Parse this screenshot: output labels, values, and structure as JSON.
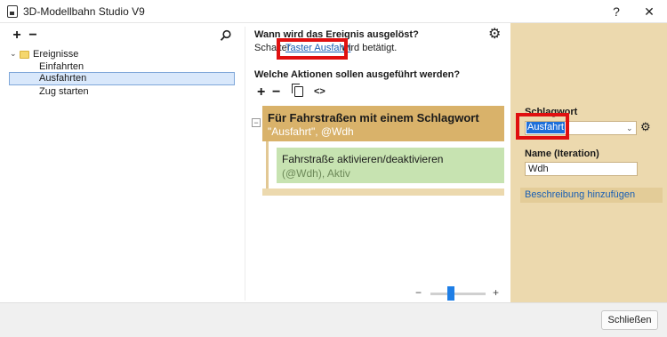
{
  "window": {
    "title": "3D-Modellbahn Studio V9",
    "help_label": "?",
    "close_label": "✕"
  },
  "tree": {
    "add_label": "+",
    "remove_label": "−",
    "search_icon": "🔍",
    "root": {
      "expand_icon": "⌄",
      "label": "Ereignisse",
      "icon": "folder-icon"
    },
    "children": [
      {
        "label": "Einfahrten"
      },
      {
        "label": "Ausfahrten",
        "selected": true
      },
      {
        "label": "Zug starten"
      }
    ]
  },
  "trigger": {
    "question": "Wann wird das Ereignis ausgelöst?",
    "prefix": "Schalter",
    "link": "Taster Ausfahrt",
    "suffix": "wird betätigt."
  },
  "actions": {
    "question": "Welche Aktionen sollen ausgeführt werden?",
    "add_label": "+",
    "remove_label": "−",
    "code_label": "<>",
    "collapse_label": "−",
    "group": {
      "title": "Für Fahrstraßen mit einem Schlagwort",
      "params": "\"Ausfahrt\", @Wdh"
    },
    "item": {
      "title": "Fahrstraße aktivieren/deaktivieren",
      "params": "(@Wdh), Aktiv"
    }
  },
  "zoom": {
    "minus_label": "−",
    "plus_label": "+",
    "level": 0.35
  },
  "properties": {
    "keyword_label": "Schlagwort",
    "keyword_value": "Ausfahrt",
    "name_label": "Name (Iteration)",
    "name_value": "Wdh",
    "description_link": "Beschreibung hinzufügen"
  },
  "footer": {
    "close_button": "Schließen"
  },
  "colors": {
    "group_header": "#d9b26a",
    "action_block": "#c7e3b1",
    "properties_bg": "#ecd9ae",
    "highlight": "#e01010",
    "selection": "#1e6fd9"
  }
}
